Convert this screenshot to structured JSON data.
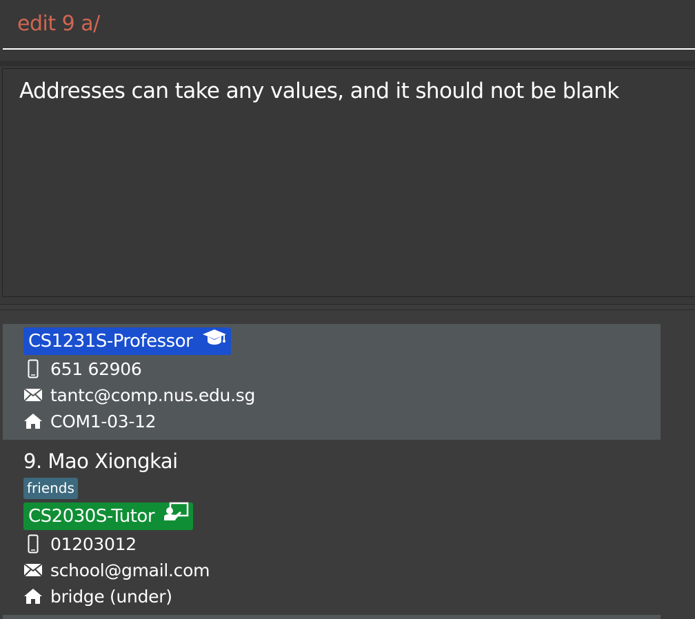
{
  "command_box": {
    "value": "edit 9 a/"
  },
  "result_display": {
    "message": "Addresses can take any values, and it should not be blank"
  },
  "person_list": {
    "cards": [
      {
        "role": "CS1231S-Professor",
        "role_icon": "graduation-cap-icon",
        "phone": "651 62906",
        "email": "tantc@comp.nus.edu.sg",
        "address": "COM1-03-12"
      },
      {
        "name": "9. Mao Xiongkai",
        "tags": [
          "friends"
        ],
        "role": "CS2030S-Tutor",
        "role_icon": "teacher-board-icon",
        "phone": "01203012",
        "email": "school@gmail.com",
        "address": "bridge (under)"
      }
    ]
  },
  "colors": {
    "command_text": "#d06651",
    "professor_tag": "#1a4fd0",
    "tutor_tag": "#108e35",
    "friend_tag": "#3d6a7e",
    "selected_card": "#525759"
  }
}
